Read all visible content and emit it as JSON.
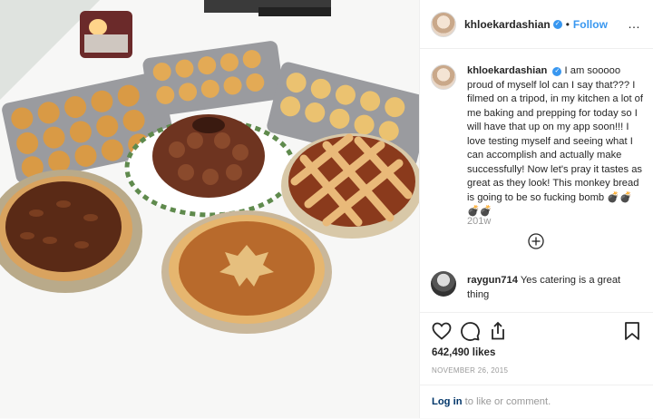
{
  "post": {
    "username": "khloekardashian",
    "verified_badge": "✓",
    "separator": "•",
    "follow_label": "Follow",
    "more_glyph": "…"
  },
  "caption": {
    "username": "khloekardashian",
    "text": "I am sooooo proud of myself lol can I say that??? I filmed on a tripod, in my kitchen a lot of me baking and prepping for today so I will have that up on my app soon!!! I love testing myself and seeing what I can accomplish and actually make successfully! Now let's pray it tastes as great as they look! This monkey bread is going to be so fucking bomb 💣💣💣💣",
    "age": "201w"
  },
  "comments": [
    {
      "username": "raygun714",
      "text": "Yes catering is a great thing"
    }
  ],
  "stats": {
    "likes": "642,490 likes",
    "date": "NOVEMBER 26, 2015"
  },
  "footer": {
    "login_link": "Log in",
    "login_rest": " to like or comment."
  },
  "icons": {
    "like": "heart-icon",
    "comment": "speech-bubble-icon",
    "share": "share-icon",
    "save": "bookmark-icon",
    "load_more": "plus-circle-icon"
  },
  "colors": {
    "link": "#3897f0",
    "text": "#262626",
    "muted": "#999999",
    "login": "#003569"
  }
}
